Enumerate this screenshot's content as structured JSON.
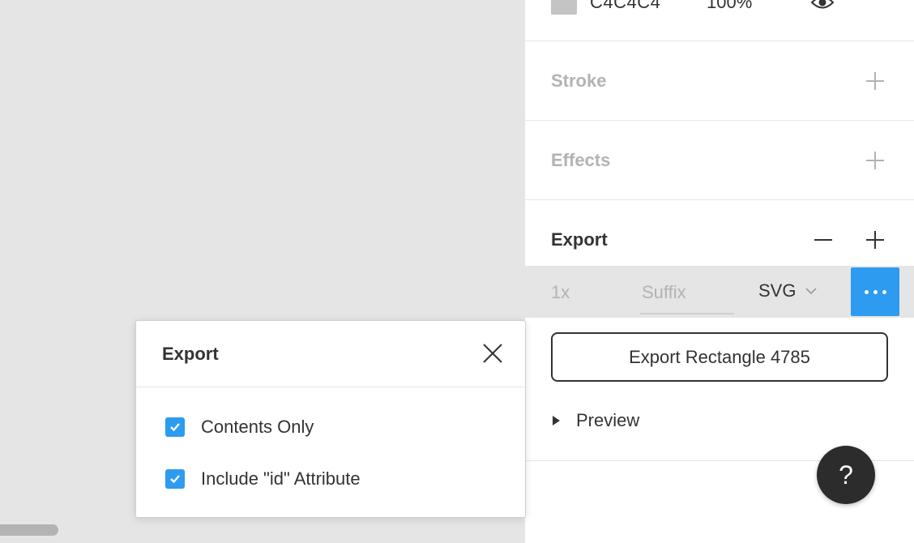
{
  "fill": {
    "hex": "C4C4C4",
    "opacity": "100%",
    "swatch_color": "#c4c4c4"
  },
  "stroke": {
    "title": "Stroke"
  },
  "effects": {
    "title": "Effects"
  },
  "export": {
    "title": "Export",
    "scale": "1x",
    "suffix_placeholder": "Suffix",
    "format": "SVG",
    "button_label": "Export Rectangle 4785",
    "preview_label": "Preview"
  },
  "popup": {
    "title": "Export",
    "options": [
      {
        "label": "Contents Only",
        "checked": true
      },
      {
        "label": "Include \"id\" Attribute",
        "checked": true
      }
    ]
  },
  "help": {
    "label": "?"
  },
  "colors": {
    "accent": "#2d9bf0",
    "panel": "#ffffff",
    "canvas": "#e5e5e5",
    "dark": "#2c2c2c"
  }
}
